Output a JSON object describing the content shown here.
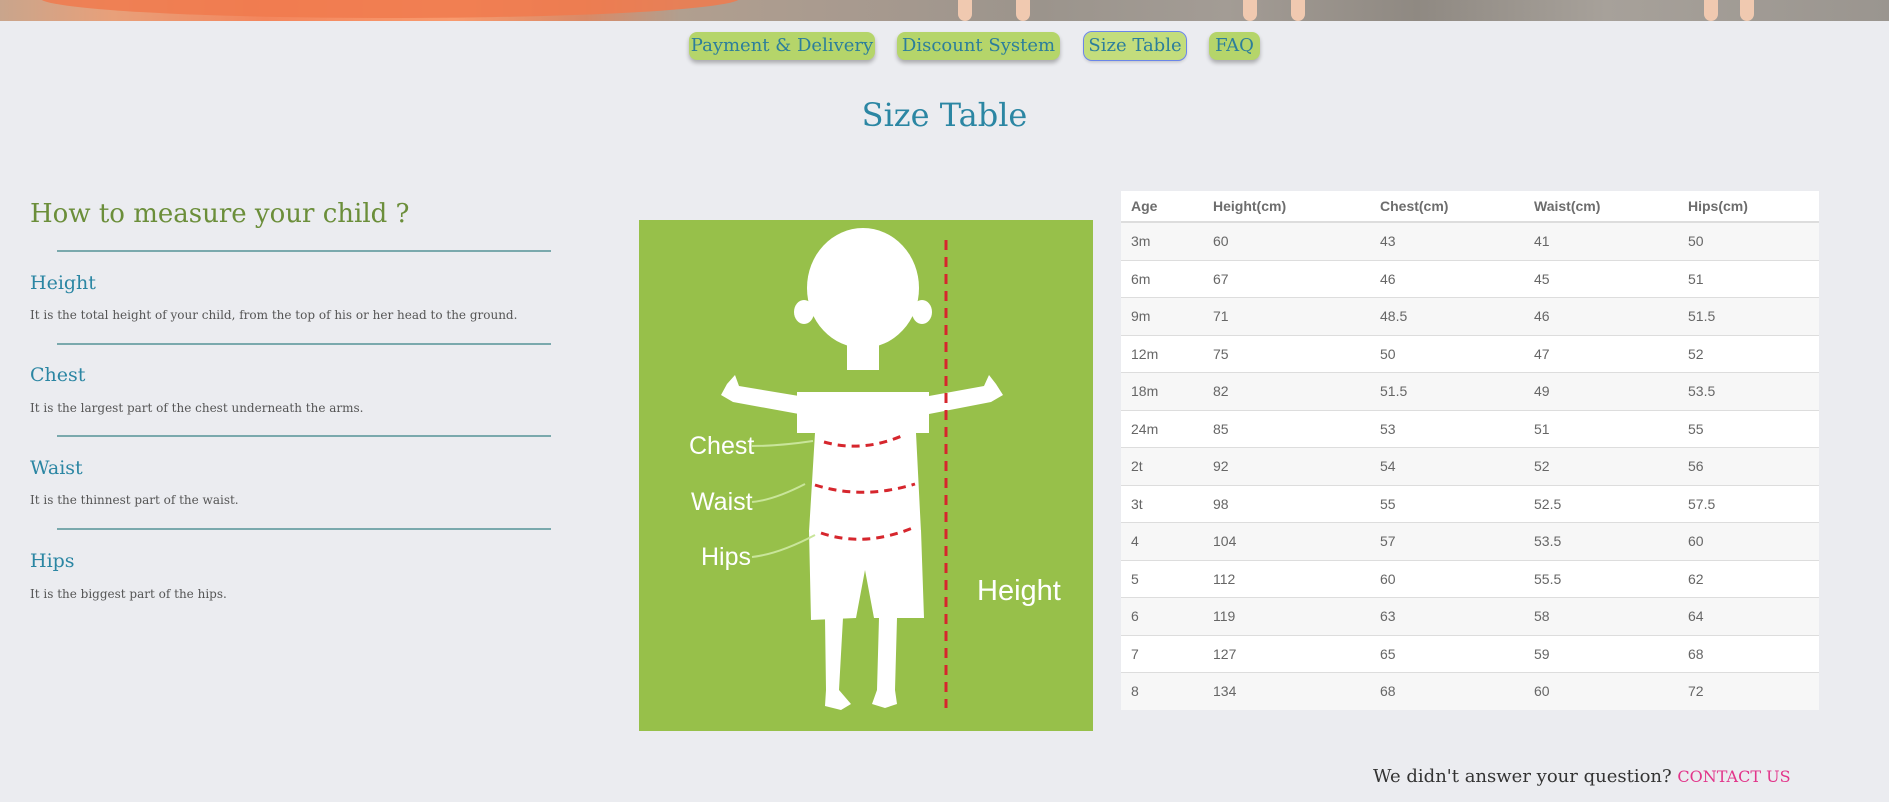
{
  "nav": {
    "tabs": [
      {
        "label": "Payment & Delivery"
      },
      {
        "label": "Discount System"
      },
      {
        "label": "Size Table"
      },
      {
        "label": "FAQ"
      }
    ]
  },
  "page": {
    "title": "Size Table"
  },
  "measure": {
    "heading": "How to measure your child ?",
    "items": [
      {
        "title": "Height",
        "desc": "It is the total height of your child, from the top of his or her head to the ground."
      },
      {
        "title": "Chest",
        "desc": "It is the largest part of the chest underneath the arms."
      },
      {
        "title": "Waist",
        "desc": "It is the thinnest part of the waist."
      },
      {
        "title": "Hips",
        "desc": "It is the biggest part of the hips."
      }
    ]
  },
  "illustration": {
    "labels": {
      "chest": "Chest",
      "waist": "Waist",
      "hips": "Hips",
      "height": "Height"
    }
  },
  "table": {
    "headers": [
      "Age",
      "Height(cm)",
      "Chest(cm)",
      "Waist(cm)",
      "Hips(cm)"
    ],
    "rows": [
      [
        "3m",
        "60",
        "43",
        "41",
        "50"
      ],
      [
        "6m",
        "67",
        "46",
        "45",
        "51"
      ],
      [
        "9m",
        "71",
        "48.5",
        "46",
        "51.5"
      ],
      [
        "12m",
        "75",
        "50",
        "47",
        "52"
      ],
      [
        "18m",
        "82",
        "51.5",
        "49",
        "53.5"
      ],
      [
        "24m",
        "85",
        "53",
        "51",
        "55"
      ],
      [
        "2t",
        "92",
        "54",
        "52",
        "56"
      ],
      [
        "3t",
        "98",
        "55",
        "52.5",
        "57.5"
      ],
      [
        "4",
        "104",
        "57",
        "53.5",
        "60"
      ],
      [
        "5",
        "112",
        "60",
        "55.5",
        "62"
      ],
      [
        "6",
        "119",
        "63",
        "58",
        "64"
      ],
      [
        "7",
        "127",
        "65",
        "59",
        "68"
      ],
      [
        "8",
        "134",
        "68",
        "60",
        "72"
      ]
    ]
  },
  "footer": {
    "question": "We didn't answer your question? ",
    "contact": "CONTACT US"
  }
}
